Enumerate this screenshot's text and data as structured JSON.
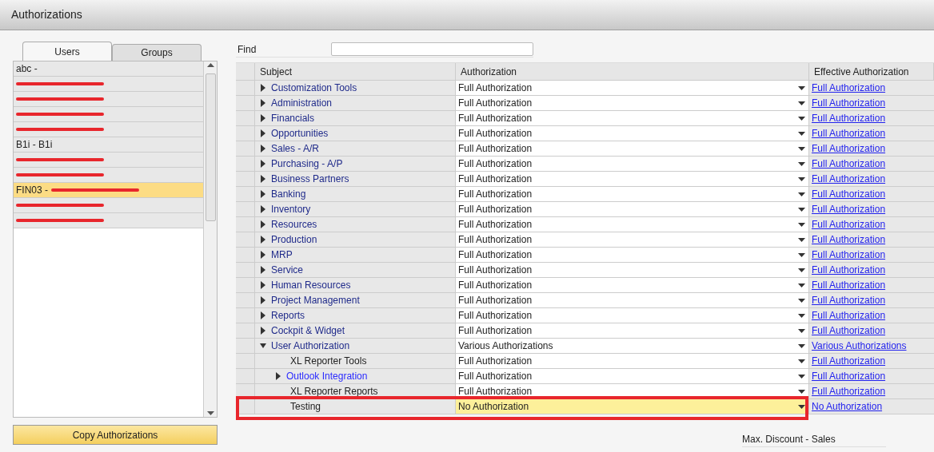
{
  "window": {
    "title": "Authorizations"
  },
  "tabs": [
    {
      "label": "Users",
      "selected": true
    },
    {
      "label": "Groups",
      "selected": false
    }
  ],
  "users": [
    {
      "text": "abc -",
      "redacted": false,
      "selected": false
    },
    {
      "redacted": true,
      "selected": false
    },
    {
      "redacted": true,
      "selected": false
    },
    {
      "redacted": true,
      "selected": false
    },
    {
      "redacted": true,
      "selected": false
    },
    {
      "text": "B1i - B1i",
      "redacted": false,
      "selected": false
    },
    {
      "redacted": true,
      "selected": false
    },
    {
      "redacted": true,
      "selected": false
    },
    {
      "text": "FIN03 -",
      "redacted": true,
      "selected": true
    },
    {
      "redacted": true,
      "selected": false
    },
    {
      "redacted": true,
      "selected": false
    }
  ],
  "copy_button": "Copy Authorizations",
  "find": {
    "label": "Find"
  },
  "table": {
    "columns": [
      "Subject",
      "Authorization",
      "Effective Authorization"
    ],
    "rows": [
      {
        "kind": "folder",
        "subject": "Customization Tools",
        "authorization": "Full Authorization",
        "effective": "Full Authorization",
        "expanded": false,
        "selected": false
      },
      {
        "kind": "folder",
        "subject": "Administration",
        "authorization": "Full Authorization",
        "effective": "Full Authorization",
        "expanded": false,
        "selected": false
      },
      {
        "kind": "folder",
        "subject": "Financials",
        "authorization": "Full Authorization",
        "effective": "Full Authorization",
        "expanded": false,
        "selected": false
      },
      {
        "kind": "folder",
        "subject": "Opportunities",
        "authorization": "Full Authorization",
        "effective": "Full Authorization",
        "expanded": false,
        "selected": false
      },
      {
        "kind": "folder",
        "subject": "Sales - A/R",
        "authorization": "Full Authorization",
        "effective": "Full Authorization",
        "expanded": false,
        "selected": false
      },
      {
        "kind": "folder",
        "subject": "Purchasing - A/P",
        "authorization": "Full Authorization",
        "effective": "Full Authorization",
        "expanded": false,
        "selected": false
      },
      {
        "kind": "folder",
        "subject": "Business Partners",
        "authorization": "Full Authorization",
        "effective": "Full Authorization",
        "expanded": false,
        "selected": false
      },
      {
        "kind": "folder",
        "subject": "Banking",
        "authorization": "Full Authorization",
        "effective": "Full Authorization",
        "expanded": false,
        "selected": false
      },
      {
        "kind": "folder",
        "subject": "Inventory",
        "authorization": "Full Authorization",
        "effective": "Full Authorization",
        "expanded": false,
        "selected": false
      },
      {
        "kind": "folder",
        "subject": "Resources",
        "authorization": "Full Authorization",
        "effective": "Full Authorization",
        "expanded": false,
        "selected": false
      },
      {
        "kind": "folder",
        "subject": "Production",
        "authorization": "Full Authorization",
        "effective": "Full Authorization",
        "expanded": false,
        "selected": false
      },
      {
        "kind": "folder",
        "subject": "MRP",
        "authorization": "Full Authorization",
        "effective": "Full Authorization",
        "expanded": false,
        "selected": false
      },
      {
        "kind": "folder",
        "subject": "Service",
        "authorization": "Full Authorization",
        "effective": "Full Authorization",
        "expanded": false,
        "selected": false
      },
      {
        "kind": "folder",
        "subject": "Human Resources",
        "authorization": "Full Authorization",
        "effective": "Full Authorization",
        "expanded": false,
        "selected": false
      },
      {
        "kind": "folder",
        "subject": "Project Management",
        "authorization": "Full Authorization",
        "effective": "Full Authorization",
        "expanded": false,
        "selected": false
      },
      {
        "kind": "folder",
        "subject": "Reports",
        "authorization": "Full Authorization",
        "effective": "Full Authorization",
        "expanded": false,
        "selected": false
      },
      {
        "kind": "folder",
        "subject": "Cockpit & Widget",
        "authorization": "Full Authorization",
        "effective": "Full Authorization",
        "expanded": false,
        "selected": false
      },
      {
        "kind": "folder",
        "subject": "User Authorization",
        "authorization": "Various Authorizations",
        "effective": "Various Authorizations",
        "expanded": true,
        "selected": false,
        "children": [
          {
            "kind": "item",
            "subject": "XL Reporter Tools",
            "authorization": "Full Authorization",
            "effective": "Full Authorization",
            "selected": false
          },
          {
            "kind": "link",
            "subject": "Outlook Integration",
            "authorization": "Full Authorization",
            "effective": "Full Authorization",
            "expanded": false,
            "selected": false
          },
          {
            "kind": "item",
            "subject": "XL Reporter Reports",
            "authorization": "Full Authorization",
            "effective": "Full Authorization",
            "selected": false
          },
          {
            "kind": "item",
            "subject": "Testing",
            "authorization": "No Authorization",
            "effective": "No Authorization",
            "selected": true,
            "highlighted": true
          }
        ]
      }
    ]
  },
  "footer": {
    "label": "Max. Discount - Sales"
  }
}
